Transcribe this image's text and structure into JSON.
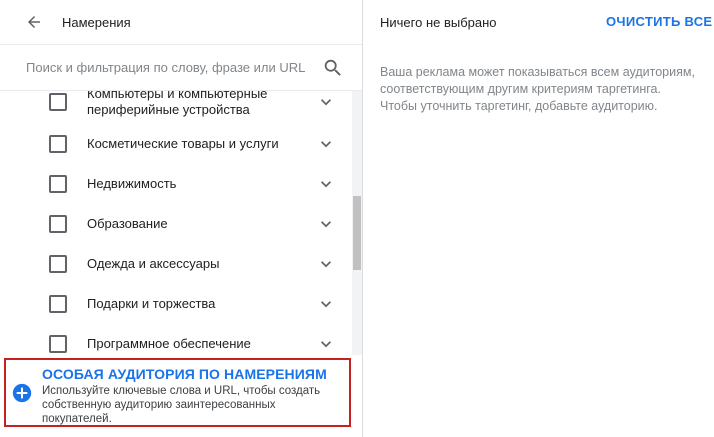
{
  "header": {
    "title": "Намерения"
  },
  "search": {
    "placeholder": "Поиск и фильтрация по слову, фразе или URL"
  },
  "list": {
    "items": [
      {
        "label": "Компьютеры и компьютерные периферийные устройства"
      },
      {
        "label": "Косметические товары и услуги"
      },
      {
        "label": "Недвижимость"
      },
      {
        "label": "Образование"
      },
      {
        "label": "Одежда и аксессуары"
      },
      {
        "label": "Подарки и торжества"
      },
      {
        "label": "Программное обеспечение"
      }
    ]
  },
  "custom_intent": {
    "title": "ОСОБАЯ АУДИТОРИЯ ПО НАМЕРЕНИЯМ",
    "description": "Используйте ключевые слова и URL, чтобы создать собственную аудиторию заинтересованных покупателей."
  },
  "selection": {
    "status": "Ничего не выбрано",
    "clear_label": "ОЧИСТИТЬ ВСЕ",
    "info": "Ваша реклама может показываться всем аудиториям, соответствующим другим критериям таргетинга. Чтобы уточнить таргетинг, добавьте аудиторию."
  },
  "colors": {
    "accent": "#1a73e8",
    "highlight_border": "#c5221f",
    "icon": "#5f6368"
  }
}
